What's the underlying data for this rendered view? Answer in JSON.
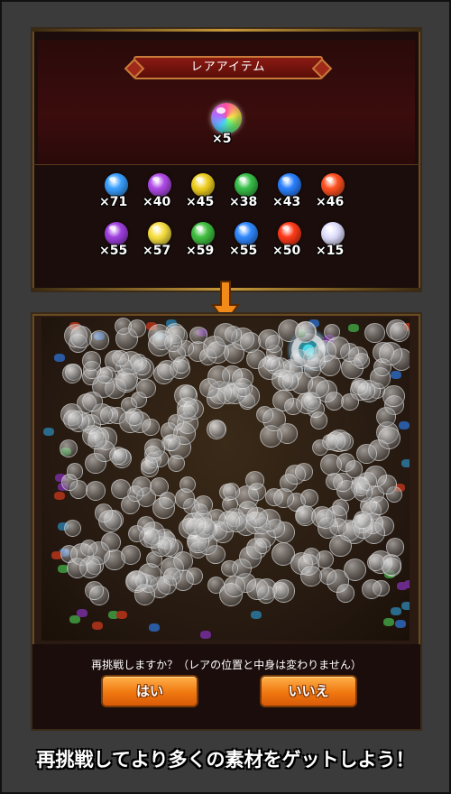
{
  "rare_panel": {
    "title": "レアアイテム",
    "rainbow_qty": "×5",
    "row1": [
      {
        "color": "#3aa0ff",
        "qty": "×71"
      },
      {
        "color": "#b04ae8",
        "qty": "×40"
      },
      {
        "color": "#f0d020",
        "qty": "×45"
      },
      {
        "color": "#38c048",
        "qty": "×38"
      },
      {
        "color": "#2a80ff",
        "qty": "×43"
      },
      {
        "color": "#ff5020",
        "qty": "×46"
      }
    ],
    "row2": [
      {
        "color": "#a040e0",
        "qty": "×55"
      },
      {
        "color": "#f8e040",
        "qty": "×57"
      },
      {
        "color": "#40c040",
        "qty": "×59"
      },
      {
        "color": "#3088ff",
        "qty": "×55"
      },
      {
        "color": "#ff3a18",
        "qty": "×50"
      },
      {
        "color": "#e0e0ff",
        "qty": "×15"
      }
    ]
  },
  "dialog": {
    "message": "再挑戦しますか？（レアの位置と中身は変わりません）",
    "yes_label": "はい",
    "no_label": "いいえ"
  },
  "footer": {
    "caption": "再挑戦してより多くの素材をゲットしよう！"
  }
}
